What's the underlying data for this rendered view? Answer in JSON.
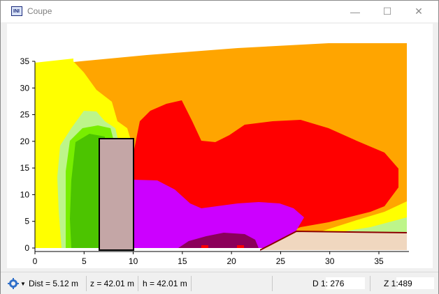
{
  "window": {
    "title": "Coupe",
    "icon": "app-window-icon"
  },
  "controls": {
    "minimize": "—",
    "maximize": "☐",
    "close": "✕"
  },
  "chart_data": {
    "type": "area",
    "description": "cross-section contour plot",
    "x_ticks": [
      "0",
      "5",
      "10",
      "15",
      "20",
      "25",
      "30",
      "35"
    ],
    "y_ticks": [
      "0",
      "5",
      "10",
      "15",
      "20",
      "25",
      "30",
      "35"
    ],
    "xlim": [
      0,
      38
    ],
    "ylim": [
      0,
      36
    ],
    "colors": {
      "yellow": "#ffff00",
      "light_yellow": "#ffff66",
      "orange": "#ffa500",
      "red": "#ff0000",
      "magenta": "#cc00ff",
      "dark_purple": "#8b005a",
      "light_green": "#bdf58a",
      "green": "#78ee00",
      "dark_green": "#4cc400",
      "building": "#c4a6a6",
      "ground": "#f0d7bf",
      "ground_line": "#8b0000"
    },
    "building": {
      "x": [
        6.6,
        10.1
      ],
      "height": 21
    },
    "ground_slope": {
      "x_start": 22.8,
      "x_top": 26.7,
      "height": 3.8
    }
  },
  "status": {
    "gear_icon": "settings-gear-icon",
    "dist": "Dist = 5.12 m",
    "z": "z = 42.01 m",
    "h": "h = 42.01 m",
    "d_scale": "D  1: 276",
    "z_scale": "Z  1:489"
  }
}
